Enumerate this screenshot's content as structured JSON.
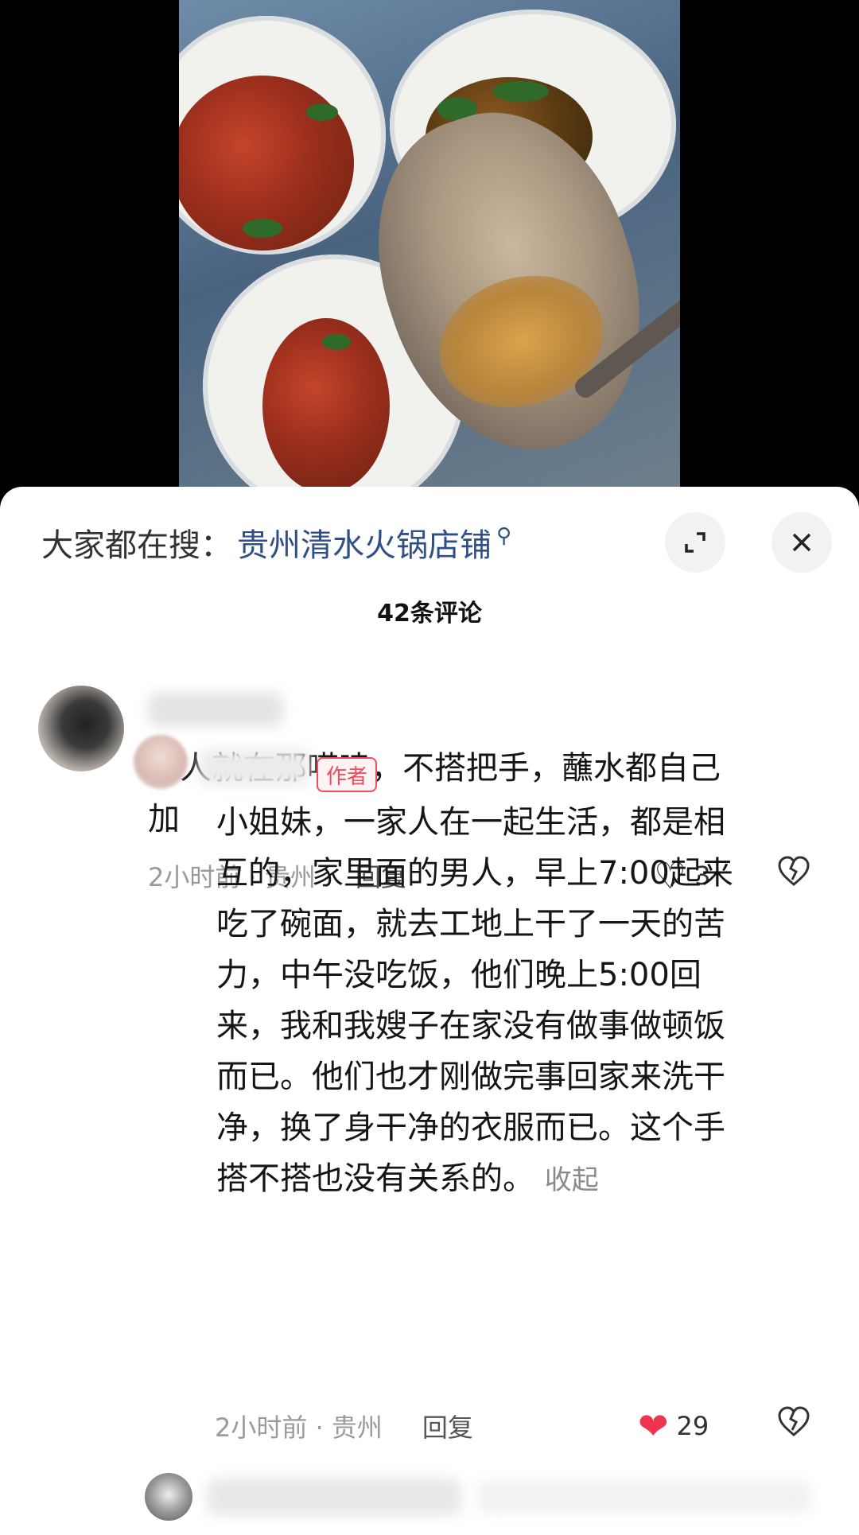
{
  "header": {
    "search_prefix": "大家都在搜：",
    "search_link": "贵州清水火锅店铺",
    "search_icon": "search-icon",
    "expand_icon": "expand-icon",
    "close_icon": "close-icon"
  },
  "comments_count": "42条评论",
  "comments": [
    {
      "text": "男人就在那唠嗑，不搭把手，蘸水都自己\n加",
      "time_location": "2小时前 · 贵州",
      "reply_label": "回复",
      "likes": "3",
      "liked": false
    },
    {
      "author_badge": "作者",
      "text": "小姐妹，一家人在一起生活，都是相\n互的，家里面的男人，早上7:00起来\n吃了碗面，就去工地上干了一天的苦\n力，中午没吃饭，他们晚上5:00回\n来，我和我嫂子在家没有做事做顿饭\n而已。他们也才刚做完事回家来洗干\n净，换了身干净的衣服而已。这个手\n搭不搭也没有关系的。",
      "fold_label": "收起",
      "time_location": "2小时前 · 贵州",
      "reply_label": "回复",
      "likes": "29",
      "liked": true
    }
  ],
  "colors": {
    "link": "#2f4f86",
    "like_active": "#f0344f",
    "badge": "#f24a5e"
  }
}
